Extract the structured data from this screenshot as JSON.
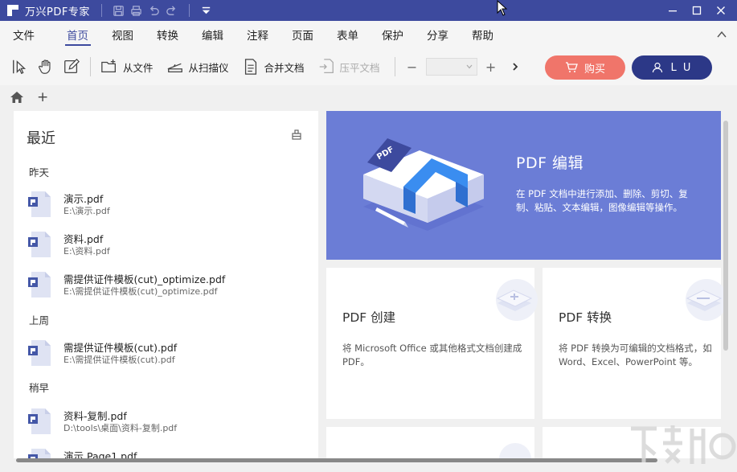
{
  "window": {
    "title": "万兴PDF专家"
  },
  "menu": {
    "items": [
      "文件",
      "首页",
      "视图",
      "转换",
      "编辑",
      "注释",
      "页面",
      "表单",
      "保护",
      "分享",
      "帮助"
    ],
    "active_index": 1
  },
  "toolbar": {
    "from_file": "从文件",
    "from_scanner": "从扫描仪",
    "merge_docs": "合并文档",
    "flatten_docs": "压平文档",
    "zoom_minus": "−",
    "zoom_plus": "+",
    "buy_label": "购买",
    "user_label": "L U"
  },
  "tabbar": {
    "add": "+"
  },
  "recent": {
    "title": "最近",
    "groups": {
      "yesterday": "昨天",
      "last_week": "上周",
      "earlier": "稍早"
    },
    "files": [
      {
        "name": "演示.pdf",
        "path": "E:\\演示.pdf"
      },
      {
        "name": "资料.pdf",
        "path": "E:\\资料.pdf"
      },
      {
        "name": "需提供证件模板(cut)_optimize.pdf",
        "path": "E:\\需提供证件模板(cut)_optimize.pdf"
      },
      {
        "name": "需提供证件模板(cut).pdf",
        "path": "E:\\需提供证件模板(cut).pdf"
      },
      {
        "name": "资料-复制.pdf",
        "path": "D:\\tools\\桌面\\资料-复制.pdf"
      },
      {
        "name": "演示.Page1.pdf",
        "path": ""
      }
    ]
  },
  "hero": {
    "badge": "PDF",
    "title": "PDF 编辑",
    "desc": "在 PDF 文档中进行添加、删除、剪切、复制、粘贴、文本编辑，图像编辑等操作。"
  },
  "cards": [
    {
      "title": "PDF 创建",
      "desc": "将 Microsoft Office 或其他格式文档创建成 PDF。"
    },
    {
      "title": "PDF 转换",
      "desc": "将 PDF 转换为可编辑的文档格式，如 Word、Excel、PowerPoint 等。"
    }
  ],
  "colors": {
    "titlebar": "#3d4a9e",
    "hero": "#6b7dd6",
    "buy": "#f0756a",
    "user": "#2c3887"
  }
}
